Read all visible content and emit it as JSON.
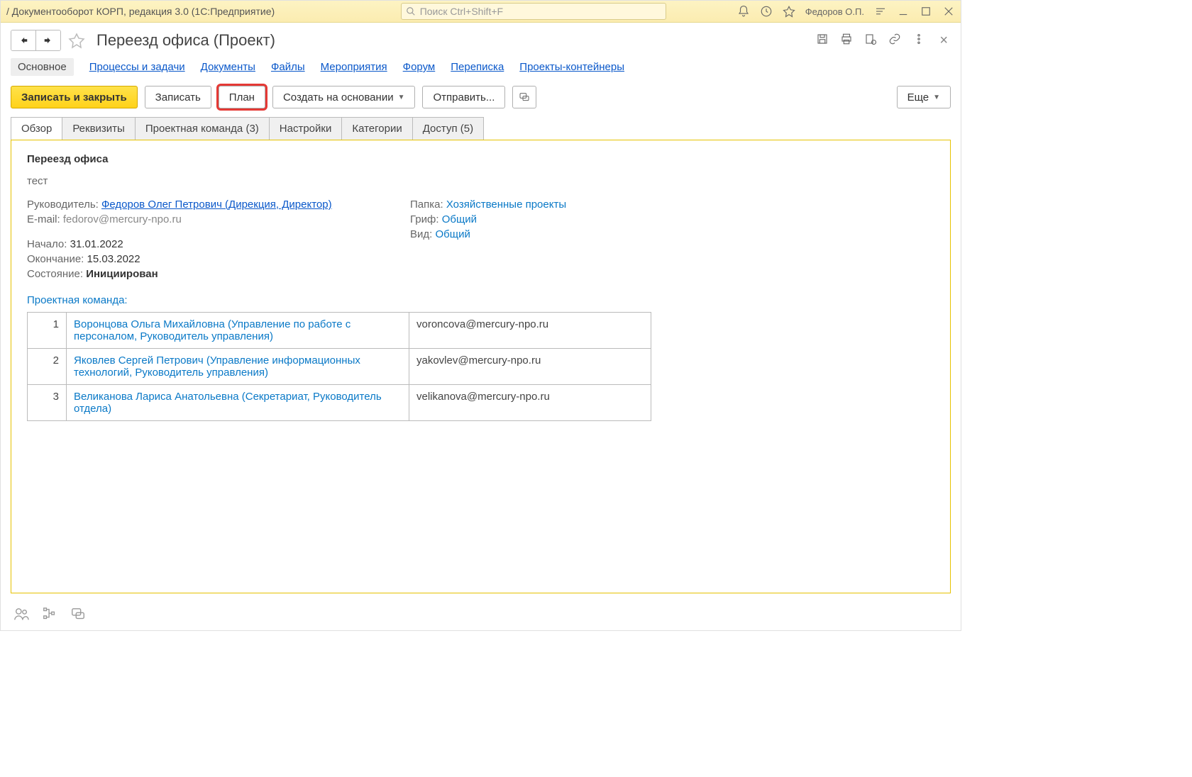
{
  "window": {
    "title": "/ Документооборот КОРП, редакция 3.0  (1С:Предприятие)",
    "search_placeholder": "Поиск Ctrl+Shift+F",
    "user": "Федоров О.П."
  },
  "header": {
    "title": "Переезд офиса (Проект)"
  },
  "navlinks": [
    "Основное",
    "Процессы и задачи",
    "Документы",
    "Файлы",
    "Мероприятия",
    "Форум",
    "Переписка",
    "Проекты-контейнеры"
  ],
  "toolbar": {
    "save_close": "Записать и закрыть",
    "save": "Записать",
    "plan": "План",
    "create_based": "Создать на основании",
    "send": "Отправить...",
    "more": "Еще"
  },
  "tabs": [
    "Обзор",
    "Реквизиты",
    "Проектная команда (3)",
    "Настройки",
    "Категории",
    "Доступ (5)"
  ],
  "overview": {
    "title": "Переезд офиса",
    "subtitle": "тест",
    "labels": {
      "leader": "Руководитель:",
      "email": "E-mail:",
      "start": "Начало:",
      "end": "Окончание:",
      "state": "Состояние:",
      "folder": "Папка:",
      "grif": "Гриф:",
      "kind": "Вид:",
      "team": "Проектная команда:"
    },
    "leader_link": "Федоров Олег Петрович (Дирекция, Директор)",
    "email": "fedorov@mercury-npo.ru",
    "start": "31.01.2022",
    "end": "15.03.2022",
    "state": "Инициирован",
    "folder": "Хозяйственные проекты",
    "grif": "Общий",
    "kind": "Общий",
    "team": [
      {
        "n": "1",
        "name": "Воронцова Ольга Михайловна (Управление по работе с персоналом, Руководитель управления)",
        "mail": "voroncova@mercury-npo.ru"
      },
      {
        "n": "2",
        "name": "Яковлев Сергей Петрович (Управление информационных технологий, Руководитель управления)",
        "mail": "yakovlev@mercury-npo.ru"
      },
      {
        "n": "3",
        "name": "Великанова Лариса Анатольевна (Секретариат, Руководитель отдела)",
        "mail": "velikanova@mercury-npo.ru"
      }
    ]
  }
}
